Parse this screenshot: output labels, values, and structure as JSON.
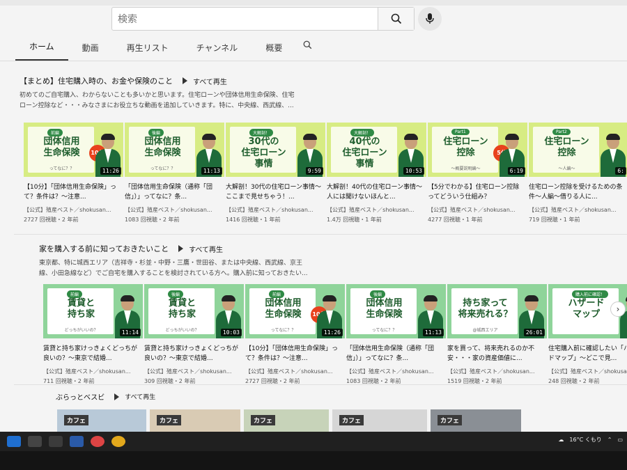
{
  "search": {
    "placeholder": "検索"
  },
  "tabs": [
    {
      "label": "ホーム"
    },
    {
      "label": "動画"
    },
    {
      "label": "再生リスト"
    },
    {
      "label": "チャンネル"
    },
    {
      "label": "概要"
    }
  ],
  "play_all_label": "すべて再生",
  "section1": {
    "title": "【まとめ】住宅購入時の、お金や保険のこと",
    "desc_line1": "初めてのご自宅購入、わからないことも多いかと思います。住宅ローンや団体信用生命保険、住宅",
    "desc_line2": "ローン控除など・・・みなさまにお役立ちな動画を追加していきます。特に、中央線、西武線、..."
  },
  "section2": {
    "title": "家を購入する前に知っておきたいこと",
    "desc_line1": "東京都、特に城西エリア（吉祥寺・杉並・中野・三鷹・世田谷、または中央線、西武線、京王",
    "desc_line2": "線、小田急線など）でご自宅を購入することを検討されている方へ。購入前に知っておきたい..."
  },
  "section3": {
    "title": "ぶらっとベスビ"
  },
  "row1": [
    {
      "tag": "前編",
      "thumb_title": "団体信用\n生命保険",
      "thumb_sub": "ってなに？？",
      "badge": "10分",
      "duration": "11:26",
      "title": "【10分】「団体信用生命保険」って？条件は？〜注意...",
      "channel": "【公式】殖産ベスト／shokusan...",
      "meta": "2727 回視聴・2 年前"
    },
    {
      "tag": "後編",
      "thumb_title": "団体信用\n生命保険",
      "thumb_sub": "ってなに？？",
      "badge": "",
      "duration": "11:13",
      "title": "「団体信用生命保険（通称「団信」）」ってなに？条...",
      "channel": "【公式】殖産ベスト／shokusan...",
      "meta": "1083 回視聴・2 年前"
    },
    {
      "tag": "大解剖！",
      "thumb_title": "30代の\n住宅ローン\n事情",
      "thumb_sub": "",
      "badge": "",
      "duration": "9:59",
      "title": "大解剖！30代の住宅ローン事情〜ここまで見せちゃう！...",
      "channel": "【公式】殖産ベスト／shokusan...",
      "meta": "1416 回視聴・1 年前"
    },
    {
      "tag": "大解剖！",
      "thumb_title": "40代の\n住宅ローン\n事情",
      "thumb_sub": "",
      "badge": "",
      "duration": "10:53",
      "title": "大解剖！40代の住宅ローン事情〜人には聞けないほんと...",
      "channel": "【公式】殖産ベスト／shokusan...",
      "meta": "1.4万 回視聴・1 年前"
    },
    {
      "tag": "Part1",
      "thumb_title": "住宅ローン\n控除",
      "thumb_sub": "〜概要説明編〜",
      "badge": "5分",
      "duration": "6:19",
      "title": "【5分でわかる】住宅ローン控除ってどういう仕組み？",
      "channel": "【公式】殖産ベスト／shokusan...",
      "meta": "4277 回視聴・1 年前"
    },
    {
      "tag": "Part2",
      "thumb_title": "住宅ローン\n控除",
      "thumb_sub": "〜人編〜",
      "badge": "",
      "duration": "6:",
      "title": "住宅ローン控除を受けるための条件〜人編〜借りる人に...",
      "channel": "【公式】殖産ベスト／shokusan...",
      "meta": "719 回視聴・1 年前"
    }
  ],
  "row2": [
    {
      "tag": "前編",
      "thumb_title": "賃貸と\n持ち家",
      "thumb_sub": "どっちがいいの？",
      "badge": "",
      "duration": "11:14",
      "title": "賃貸と持ち家けっきょくどっちが良いの？〜東京で結婚...",
      "channel": "【公式】殖産ベスト／shokusan...",
      "meta": "711 回視聴・2 年前"
    },
    {
      "tag": "後編",
      "thumb_title": "賃貸と\n持ち家",
      "thumb_sub": "どっちがいいの？",
      "badge": "",
      "duration": "10:03",
      "title": "賃貸と持ち家けっきょくどっちが良いの？〜東京で結婚...",
      "channel": "【公式】殖産ベスト／shokusan...",
      "meta": "309 回視聴・2 年前"
    },
    {
      "tag": "前編",
      "thumb_title": "団体信用\n生命保険",
      "thumb_sub": "ってなに？？",
      "badge": "10分",
      "duration": "11:26",
      "title": "【10分】「団体信用生命保険」って？条件は？〜注意...",
      "channel": "【公式】殖産ベスト／shokusan...",
      "meta": "2727 回視聴・2 年前"
    },
    {
      "tag": "後編",
      "thumb_title": "団体信用\n生命保険",
      "thumb_sub": "ってなに？？",
      "badge": "",
      "duration": "11:13",
      "title": "「団体信用生命保険（通称「団信」）」ってなに？条...",
      "channel": "【公式】殖産ベスト／shokusan...",
      "meta": "1083 回視聴・2 年前"
    },
    {
      "tag": "",
      "thumb_title": "持ち家って\n将来売れる？",
      "thumb_sub": "@城西エリア",
      "badge": "",
      "duration": "26:01",
      "title": "家を買って、将来売れるのか不安・・・家の資産価値に...",
      "channel": "【公式】殖産ベスト／shokusan...",
      "meta": "1519 回視聴・2 年前"
    },
    {
      "tag": "購入前に確認！",
      "thumb_title": "ハザード\nマップ",
      "thumb_sub": "",
      "badge": "",
      "duration": "5:38",
      "title": "住宅購入前に確認したい「ハザードマップ」〜どこで見...",
      "channel": "【公式】殖産ベスト／shokusan...",
      "meta": "248 回視聴・2 年前"
    }
  ],
  "row3_thumbs": [
    {
      "label": "カフェ"
    },
    {
      "label": "カフェ"
    },
    {
      "label": "カフェ"
    },
    {
      "label": "カフェ"
    },
    {
      "label": "カフェ"
    }
  ],
  "taskbar": {
    "weather": "16°C くもり"
  },
  "colors": {
    "thumb_green": "#d7ec83",
    "thumb_mint": "#8fd49a",
    "brand_green": "#1f5e2e",
    "badge_red": "#e8421d"
  }
}
